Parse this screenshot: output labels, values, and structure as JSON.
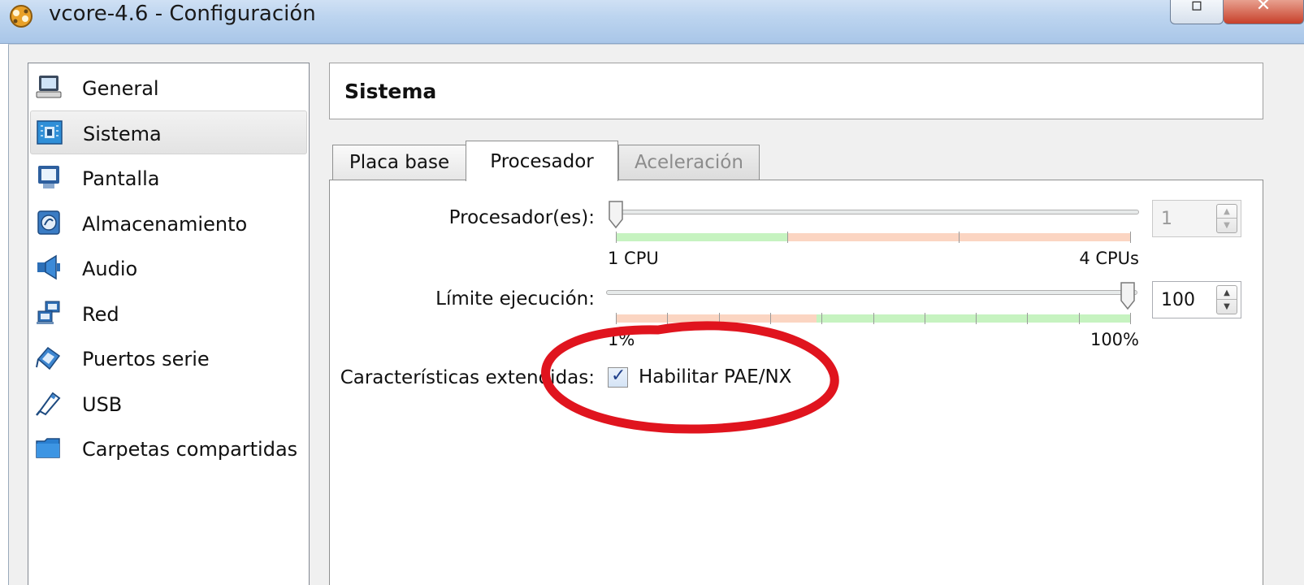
{
  "window": {
    "title": "vcore-4.6 - Configuración",
    "maximize_glyph": "▫",
    "close_glyph": "✕"
  },
  "sidebar": {
    "items": [
      {
        "label": "General",
        "icon": "monitor-icon"
      },
      {
        "label": "Sistema",
        "icon": "chip-icon",
        "selected": true
      },
      {
        "label": "Pantalla",
        "icon": "display-icon"
      },
      {
        "label": "Almacenamiento",
        "icon": "disk-icon"
      },
      {
        "label": "Audio",
        "icon": "speaker-icon"
      },
      {
        "label": "Red",
        "icon": "network-icon"
      },
      {
        "label": "Puertos serie",
        "icon": "serial-port-icon"
      },
      {
        "label": "USB",
        "icon": "usb-icon"
      },
      {
        "label": "Carpetas compartidas",
        "icon": "folder-icon"
      }
    ]
  },
  "section": {
    "title": "Sistema"
  },
  "tabs": [
    {
      "label": "Placa base",
      "state": "inactive"
    },
    {
      "label": "Procesador",
      "state": "active"
    },
    {
      "label": "Aceleración",
      "state": "disabled"
    }
  ],
  "processors": {
    "label": "Procesador(es):",
    "value": "1",
    "min_label": "1 CPU",
    "max_label": "4 CPUs",
    "slider_fraction": 0.0
  },
  "exec_cap": {
    "label": "Límite ejecución:",
    "value": "100",
    "min_label": "1%",
    "max_label": "100%",
    "slider_fraction": 1.0
  },
  "extended": {
    "label": "Características extendidas:",
    "checkbox_label": "Habilitar PAE/NX",
    "checked": true
  },
  "spin_arrows": {
    "up": "▲",
    "down": "▼"
  },
  "colors": {
    "annotation": "#e0141e",
    "band_good": "#c6f3c0",
    "band_warn": "#fbd5c2"
  }
}
